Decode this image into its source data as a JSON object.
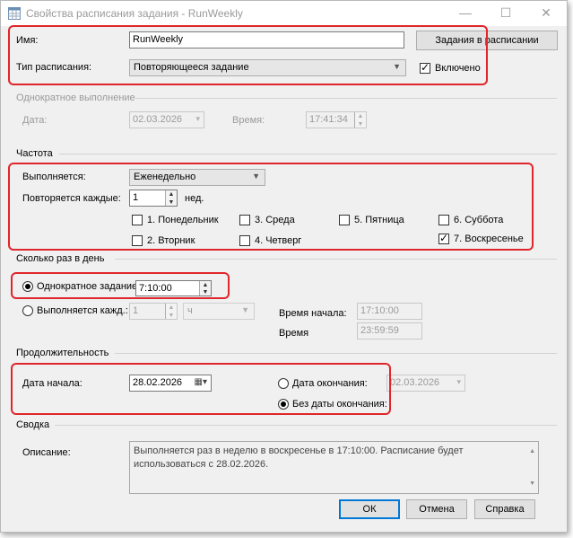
{
  "window": {
    "title": "Свойства расписания задания - RunWeekly"
  },
  "top": {
    "name_label": "Имя:",
    "name_value": "RunWeekly",
    "jobs_button": "Задания в расписании",
    "type_label": "Тип расписания:",
    "type_value": "Повторяющееся задание",
    "enabled_label": "Включено"
  },
  "once": {
    "header": "Однократное выполнение",
    "date_label": "Дата:",
    "date_value": "02.03.2026",
    "time_label": "Время:",
    "time_value": "17:41:34"
  },
  "frequency": {
    "header": "Частота",
    "occurs_label": "Выполняется:",
    "occurs_value": "Еженедельно",
    "recurs_label": "Повторяется каждые:",
    "recurs_value": "1",
    "recurs_unit": "нед.",
    "days": [
      {
        "label": "1. Понедельник",
        "checked": false
      },
      {
        "label": "2. Вторник",
        "checked": false
      },
      {
        "label": "3. Среда",
        "checked": false
      },
      {
        "label": "4. Четверг",
        "checked": false
      },
      {
        "label": "5. Пятница",
        "checked": false
      },
      {
        "label": "6. Суббота",
        "checked": false
      },
      {
        "label": "7. Воскресенье",
        "checked": true
      }
    ]
  },
  "daily": {
    "header": "Сколько раз в день",
    "once_label": "Однократное задание:",
    "once_time": "7:10:00",
    "every_label": "Выполняется кажд.:",
    "every_value": "1",
    "every_unit": "ч",
    "start_label": "Время начала:",
    "start_value": "17:10:00",
    "end_label": "Время",
    "end_value": "23:59:59"
  },
  "duration": {
    "header": "Продолжительность",
    "start_label": "Дата начала:",
    "start_value": "28.02.2026",
    "end_label": "Дата окончания:",
    "end_value": "02.03.2026",
    "no_end_label": "Без даты окончания:"
  },
  "summary": {
    "header": "Сводка",
    "description_label": "Описание:",
    "description_value": "Выполняется раз в неделю в воскресенье в 17:10:00. Расписание будет использоваться с 28.02.2026."
  },
  "buttons": {
    "ok": "ОК",
    "cancel": "Отмена",
    "help": "Справка"
  }
}
